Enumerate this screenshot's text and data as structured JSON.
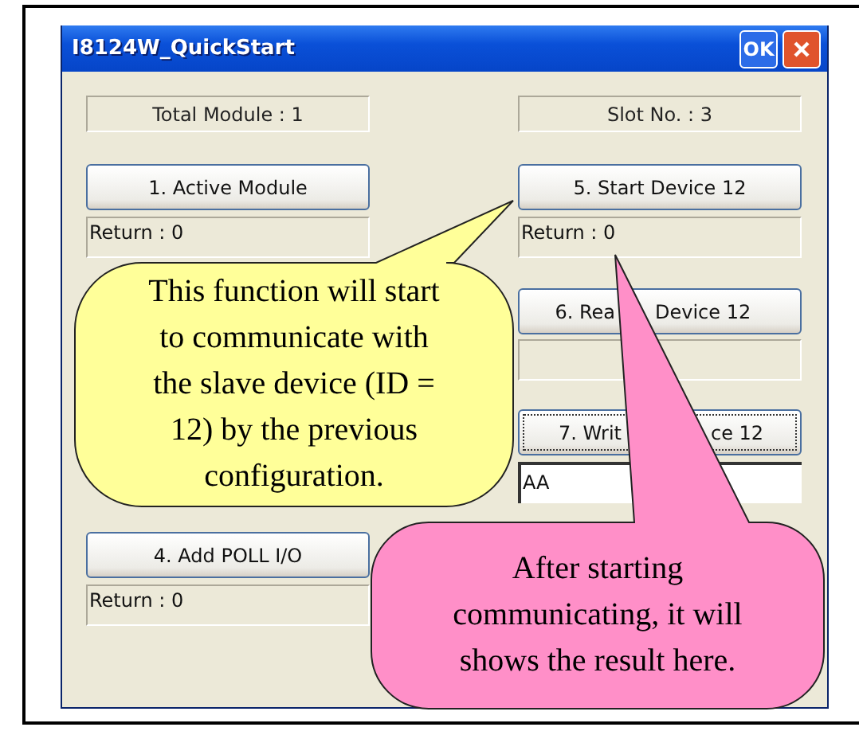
{
  "window": {
    "title": "I8124W_QuickStart",
    "ok_button": "OK"
  },
  "left_column": [
    {
      "kind": "label",
      "text": "Total Module : 1"
    },
    {
      "kind": "button",
      "label": "1. Active Module",
      "focused": false
    },
    {
      "kind": "output",
      "text": "Return : 0"
    },
    {
      "kind": "button",
      "label": "4. Add POLL I/O",
      "focused": false
    },
    {
      "kind": "output",
      "text": "Return : 0"
    }
  ],
  "right_column": [
    {
      "kind": "label",
      "text": "Slot No. : 3"
    },
    {
      "kind": "button",
      "label": "5. Start Device 12",
      "focused": false
    },
    {
      "kind": "output",
      "text": "Return : 0"
    },
    {
      "kind": "button",
      "label_parts": [
        "6. Rea",
        "Device 12"
      ],
      "focused": false
    },
    {
      "kind": "output"
    },
    {
      "kind": "button",
      "label_parts": [
        "7. Writ",
        "ce 12"
      ],
      "focused": true
    },
    {
      "kind": "input",
      "value": "AA"
    }
  ],
  "callouts": [
    {
      "text": "This function will start to communicate with the slave device (ID = 12) by the previous configuration.",
      "color": "#ffff99"
    },
    {
      "text": "After starting communicating, it will shows the result here.",
      "color": "#ff8fc8"
    }
  ]
}
